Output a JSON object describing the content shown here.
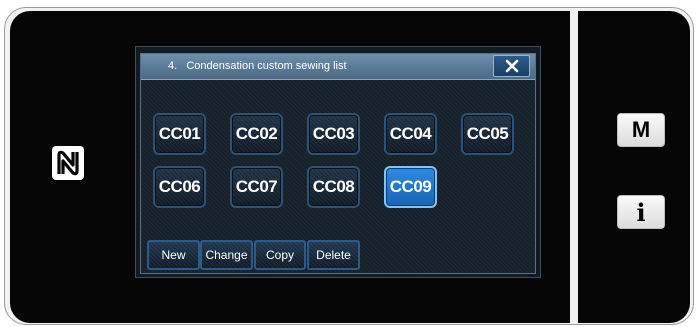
{
  "dialog": {
    "title": "4.   Condensation custom sewing list",
    "close_icon": "close-icon"
  },
  "patterns": [
    {
      "label": "CC01",
      "selected": false
    },
    {
      "label": "CC02",
      "selected": false
    },
    {
      "label": "CC03",
      "selected": false
    },
    {
      "label": "CC04",
      "selected": false
    },
    {
      "label": "CC05",
      "selected": false
    },
    {
      "label": "CC06",
      "selected": false
    },
    {
      "label": "CC07",
      "selected": false
    },
    {
      "label": "CC08",
      "selected": false
    },
    {
      "label": "CC09",
      "selected": true
    }
  ],
  "actions": {
    "new": "New",
    "change": "Change",
    "copy": "Copy",
    "delete": "Delete"
  },
  "side_panel": {
    "mode_label": "M",
    "info_label": "i"
  },
  "icons": {
    "nfc": "nfc-icon"
  },
  "colors": {
    "selected_button": "#1f78cc",
    "title_bar": "#5a7c99"
  }
}
